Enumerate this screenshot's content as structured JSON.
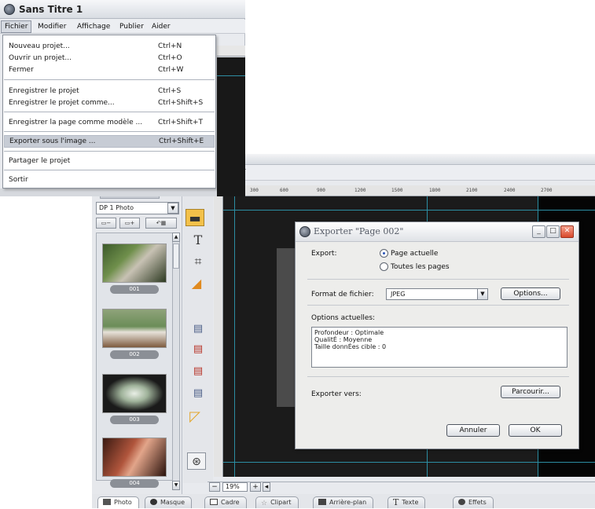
{
  "app": {
    "title": "Sans Titre 1",
    "menubar": [
      "Fichier",
      "Modifier",
      "Affichage",
      "Publier",
      "Aider"
    ],
    "file_menu": [
      {
        "label": "Nouveau projet...",
        "shortcut": "Ctrl+N"
      },
      {
        "label": "Ouvrir un projet...",
        "shortcut": "Ctrl+O"
      },
      {
        "label": "Fermer",
        "shortcut": "Ctrl+W"
      },
      {
        "label": "Enregistrer le projet",
        "shortcut": "Ctrl+S"
      },
      {
        "label": "Enregistrer le projet comme...",
        "shortcut": "Ctrl+Shift+S"
      },
      {
        "label": "Enregistrer la page comme modèle ...",
        "shortcut": "Ctrl+Shift+T"
      },
      {
        "label": "Exporter sous l'image ...",
        "shortcut": "Ctrl+Shift+E"
      },
      {
        "label": "Partager le projet",
        "shortcut": ""
      },
      {
        "label": "Sortir",
        "shortcut": ""
      }
    ],
    "highlighted_menu_item": "Exporter sous l'image ..."
  },
  "editor": {
    "menubar_tail": "r",
    "ruler_ticks": [
      "300",
      "600",
      "900",
      "1200",
      "1500",
      "1800",
      "2100",
      "2400",
      "2700"
    ],
    "photo_panel": {
      "dropdown_value": "DP 1 Photo",
      "thumbnails": [
        "001",
        "002",
        "003",
        "004"
      ]
    },
    "zoom": "19%"
  },
  "bottom_tabs": [
    "Photo",
    "Masque",
    "Cadre",
    "Clipart",
    "Arrière-plan",
    "Texte",
    "Effets"
  ],
  "dialog": {
    "title": "Exporter \"Page 002\"",
    "export_label": "Export:",
    "radio_current": "Page actuelle",
    "radio_all": "Toutes les pages",
    "format_label": "Format de fichier:",
    "format_value": "JPEG",
    "options_button": "Options...",
    "current_options_label": "Options actuelles:",
    "current_options": [
      "Profondeur : Optimale",
      "QualitÉ : Moyenne",
      "Taille donnÉes cible : 0"
    ],
    "export_to_label": "Exporter vers:",
    "browse_button": "Parcourir...",
    "cancel_button": "Annuler",
    "ok_button": "OK"
  },
  "colors": {
    "guide": "#2c8ea3",
    "canvas": "#1b1b1b",
    "close_button": "#d9482a",
    "highlight": "#c7ccd5"
  }
}
